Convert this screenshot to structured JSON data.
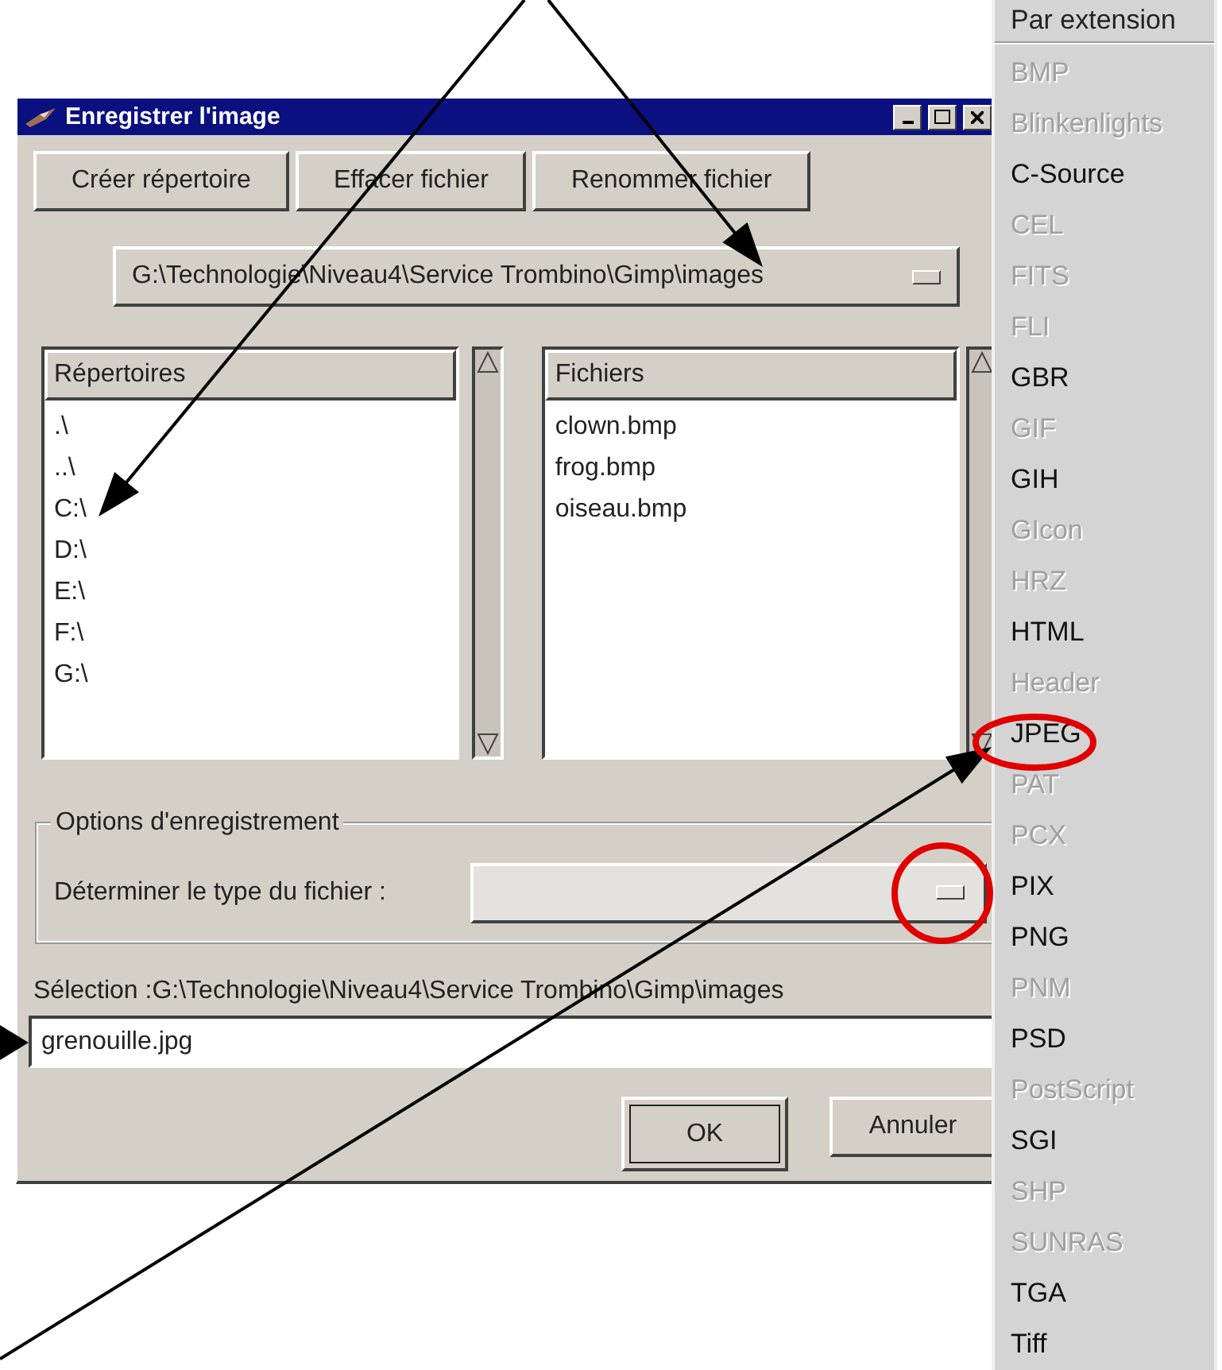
{
  "dialog": {
    "title": "Enregistrer l'image",
    "buttons": [
      "Créer répertoire",
      "Effacer fichier",
      "Renommer fichier"
    ],
    "path": "G:\\Technologie\\Niveau4\\Service Trombino\\Gimp\\images",
    "directories": {
      "header": "Répertoires",
      "items": [
        ".\\",
        "..\\",
        "C:\\",
        "D:\\",
        "E:\\",
        "F:\\",
        "G:\\"
      ]
    },
    "files": {
      "header": "Fichiers",
      "items": [
        "clown.bmp",
        "frog.bmp",
        "oiseau.bmp"
      ]
    },
    "options": {
      "legend": "Options d'enregistrement",
      "label": "Déterminer le type du fichier :"
    },
    "selection": "Sélection :G:\\Technologie\\Niveau4\\Service Trombino\\Gimp\\images",
    "filename": "grenouille.jpg",
    "actions": [
      {
        "label": "OK",
        "default": true
      },
      {
        "label": "Annuler",
        "default": false
      }
    ]
  },
  "type_menu": {
    "header": "Par extension",
    "items": [
      {
        "label": "BMP",
        "disabled": true
      },
      {
        "label": "Blinkenlights",
        "disabled": true
      },
      {
        "label": "C-Source",
        "disabled": false
      },
      {
        "label": "CEL",
        "disabled": true
      },
      {
        "label": "FITS",
        "disabled": true
      },
      {
        "label": "FLI",
        "disabled": true
      },
      {
        "label": "GBR",
        "disabled": false
      },
      {
        "label": "GIF",
        "disabled": true
      },
      {
        "label": "GIH",
        "disabled": false
      },
      {
        "label": "GIcon",
        "disabled": true
      },
      {
        "label": "HRZ",
        "disabled": true
      },
      {
        "label": "HTML",
        "disabled": false
      },
      {
        "label": "Header",
        "disabled": true
      },
      {
        "label": "JPEG",
        "disabled": false
      },
      {
        "label": "PAT",
        "disabled": true
      },
      {
        "label": "PCX",
        "disabled": true
      },
      {
        "label": "PIX",
        "disabled": false
      },
      {
        "label": "PNG",
        "disabled": false
      },
      {
        "label": "PNM",
        "disabled": true
      },
      {
        "label": "PSD",
        "disabled": false
      },
      {
        "label": "PostScript",
        "disabled": true
      },
      {
        "label": "SGI",
        "disabled": false
      },
      {
        "label": "SHP",
        "disabled": true
      },
      {
        "label": "SUNRAS",
        "disabled": true
      },
      {
        "label": "TGA",
        "disabled": false
      },
      {
        "label": "Tiff",
        "disabled": false
      }
    ]
  }
}
